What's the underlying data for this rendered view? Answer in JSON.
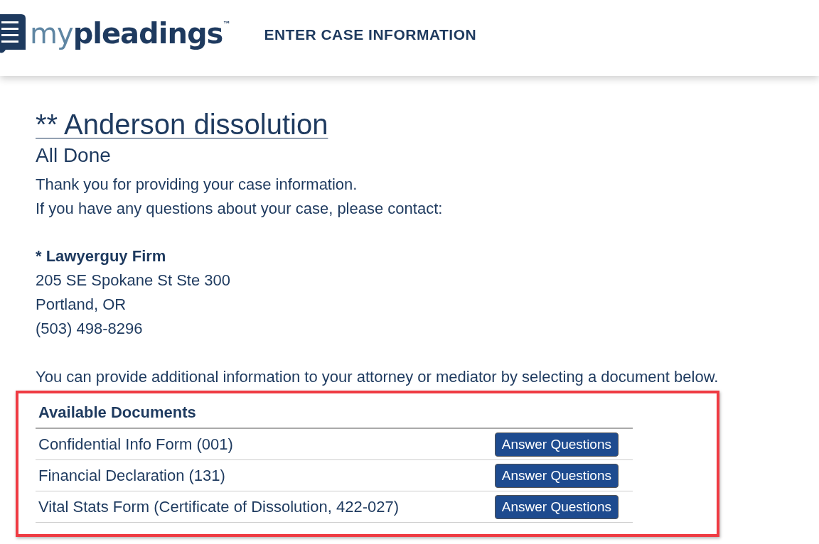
{
  "header": {
    "logo": {
      "prefix": "my",
      "name": "pleadings",
      "trademark": "™"
    },
    "title": "ENTER CASE INFORMATION"
  },
  "case_title": "** Anderson dissolution",
  "subtitle": "All Done",
  "message_lines": [
    "Thank you for providing your case information.",
    "If you have any questions about your case, please contact:"
  ],
  "contact": {
    "firm": "* Lawyerguy Firm",
    "address_lines": [
      "205 SE Spokane St Ste 300",
      "Portland, OR"
    ],
    "phone": "(503) 498-8296"
  },
  "instructions": "You can provide additional information to your attorney or mediator by selecting a document below.",
  "documents": {
    "heading": "Available Documents",
    "rows": [
      {
        "name": "Confidential Info Form (001)",
        "action": "Answer Questions"
      },
      {
        "name": "Financial Declaration (131)",
        "action": "Answer Questions"
      },
      {
        "name": "Vital Stats Form (Certificate of Dissolution, 422-027)",
        "action": "Answer Questions"
      }
    ]
  }
}
